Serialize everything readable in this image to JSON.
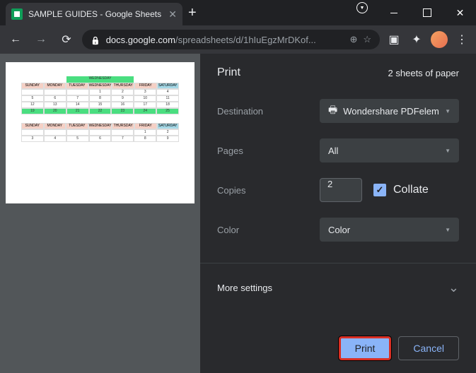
{
  "tab": {
    "title": "SAMPLE GUIDES - Google Sheets"
  },
  "url": {
    "domain": "docs.google.com",
    "path": "/spreadsheets/d/1hIuEgzMrDKof..."
  },
  "print": {
    "title": "Print",
    "sheet_count": "2 sheets of paper",
    "destination_label": "Destination",
    "destination_value": "Wondershare PDFelem",
    "pages_label": "Pages",
    "pages_value": "All",
    "copies_label": "Copies",
    "copies_value": "2",
    "collate_label": "Collate",
    "color_label": "Color",
    "color_value": "Color",
    "more_label": "More settings",
    "print_button": "Print",
    "cancel_button": "Cancel"
  },
  "preview": {
    "days": [
      "SUNDAY",
      "MONDAY",
      "TUESDAY",
      "WEDNESDAY",
      "THURSDAY",
      "FRIDAY",
      "SATURDAY"
    ],
    "cal1": {
      "title": "WEDNESDAY",
      "rows": [
        [
          "",
          "",
          "",
          "1",
          "2",
          "3",
          "4"
        ],
        [
          "5",
          "6",
          "7",
          "8",
          "9",
          "10",
          "11"
        ],
        [
          "12",
          "13",
          "14",
          "15",
          "16",
          "17",
          "18"
        ],
        [
          "19",
          "20",
          "21",
          "22",
          "23",
          "24",
          "25"
        ]
      ]
    },
    "cal2": {
      "rows": [
        [
          "",
          "",
          "",
          "",
          "",
          "1",
          "2"
        ],
        [
          "3",
          "4",
          "5",
          "6",
          "7",
          "8",
          "9"
        ]
      ]
    }
  }
}
